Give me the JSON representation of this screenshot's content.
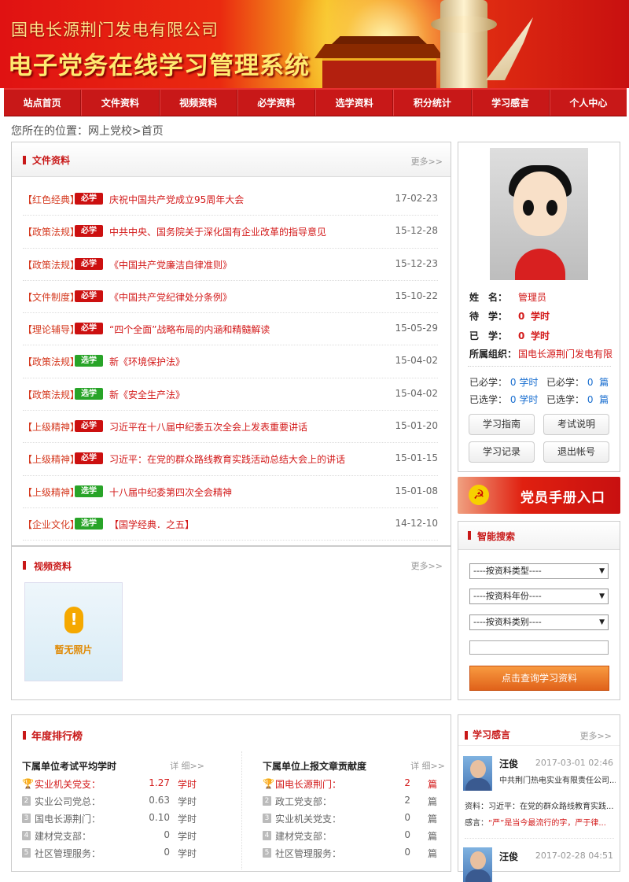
{
  "banner": {
    "company": "国电长源荆门发电有限公司",
    "system": "电子党务在线学习管理系统"
  },
  "nav": [
    "站点首页",
    "文件资料",
    "视频资料",
    "必学资料",
    "选学资料",
    "积分统计",
    "学习感言",
    "个人中心"
  ],
  "breadcrumb": "您所在的位置：网上党校>首页",
  "docs": {
    "title": "文件资料",
    "more": "更多>>",
    "items": [
      {
        "cat": "【红色经典】",
        "type": "必学",
        "title": "庆祝中国共产党成立95周年大会",
        "date": "17-02-23"
      },
      {
        "cat": "【政策法规】",
        "type": "必学",
        "title": "中共中央、国务院关于深化国有企业改革的指导意见",
        "date": "15-12-28"
      },
      {
        "cat": "【政策法规】",
        "type": "必学",
        "title": "《中国共产党廉洁自律准则》",
        "date": "15-12-23"
      },
      {
        "cat": "【文件制度】",
        "type": "必学",
        "title": "《中国共产党纪律处分条例》",
        "date": "15-10-22"
      },
      {
        "cat": "【理论辅导】",
        "type": "必学",
        "title": "“四个全面”战略布局的内涵和精髓解读",
        "date": "15-05-29"
      },
      {
        "cat": "【政策法规】",
        "type": "选学",
        "title": "新《环境保护法》",
        "date": "15-04-02"
      },
      {
        "cat": "【政策法规】",
        "type": "选学",
        "title": "新《安全生产法》",
        "date": "15-04-02"
      },
      {
        "cat": "【上级精神】",
        "type": "必学",
        "title": "习近平在十八届中纪委五次全会上发表重要讲话",
        "date": "15-01-20"
      },
      {
        "cat": "【上级精神】",
        "type": "必学",
        "title": "习近平：在党的群众路线教育实践活动总结大会上的讲话",
        "date": "15-01-15"
      },
      {
        "cat": "【上级精神】",
        "type": "选学",
        "title": "十八届中纪委第四次全会精神",
        "date": "15-01-08"
      },
      {
        "cat": "【企业文化】",
        "type": "选学",
        "title": "【国学经典．之五】",
        "date": "14-12-10"
      }
    ]
  },
  "video": {
    "title": "视频资料",
    "more": "更多>>",
    "no_image": "暂无照片"
  },
  "profile": {
    "name_label": "姓　名：",
    "name": "管理员",
    "pending_label": "待　学：",
    "pending": "0",
    "pending_unit": "学时",
    "done_label": "已　学：",
    "done": "0",
    "done_unit": "学时",
    "org_label": "所属组织：",
    "org": "国电长源荆门发电有限",
    "req_hours_label": "已必学：",
    "req_hours": "0",
    "hours_unit": "学时",
    "req_count_label": "已必学：",
    "req_count": "0",
    "count_unit": "篇",
    "opt_hours_label": "已选学：",
    "opt_hours": "0",
    "opt_count_label": "已选学：",
    "opt_count": "0",
    "buttons": [
      "学习指南",
      "考试说明",
      "学习记录",
      "退出帐号"
    ]
  },
  "party_manual": "党员手册入口",
  "search": {
    "title": "智能搜索",
    "type": "----按资料类型----",
    "year": "----按资料年份----",
    "category": "----按资料类别----",
    "input_value": "",
    "button": "点击查询学习资料"
  },
  "ranking": {
    "title": "年度排行榜",
    "left": {
      "title": "下属单位考试平均学时",
      "more": "详 细>>",
      "rows": [
        {
          "no": "1",
          "name": "实业机关党支：",
          "value": "1.27",
          "unit": "学时"
        },
        {
          "no": "2",
          "name": "实业公司党总：",
          "value": "0.63",
          "unit": "学时"
        },
        {
          "no": "3",
          "name": "国电长源荆门：",
          "value": "0.10",
          "unit": "学时"
        },
        {
          "no": "4",
          "name": "建材党支部：",
          "value": "0",
          "unit": "学时"
        },
        {
          "no": "5",
          "name": "社区管理服务：",
          "value": "0",
          "unit": "学时"
        }
      ]
    },
    "right": {
      "title": "下属单位上报文章贡献度",
      "more": "详 细>>",
      "rows": [
        {
          "no": "1",
          "name": "国电长源荆门：",
          "value": "2",
          "unit": "篇"
        },
        {
          "no": "2",
          "name": "政工党支部：",
          "value": "2",
          "unit": "篇"
        },
        {
          "no": "3",
          "name": "实业机关党支：",
          "value": "0",
          "unit": "篇"
        },
        {
          "no": "4",
          "name": "建材党支部：",
          "value": "0",
          "unit": "篇"
        },
        {
          "no": "5",
          "name": "社区管理服务：",
          "value": "0",
          "unit": "篇"
        }
      ]
    }
  },
  "learning": {
    "title": "学习感言",
    "more": "更多>>",
    "items": [
      {
        "name": "汪俊",
        "date": "2017-03-01 02:46",
        "org": "中共荆门热电实业有限责任公司...",
        "material_label": "资料：",
        "material": "习近平：在党的群众路线教育实践...",
        "comment_label": "感言：",
        "comment": "“严”是当今最流行的字，严于律..."
      },
      {
        "name": "汪俊",
        "date": "2017-02-28 04:51"
      }
    ]
  }
}
